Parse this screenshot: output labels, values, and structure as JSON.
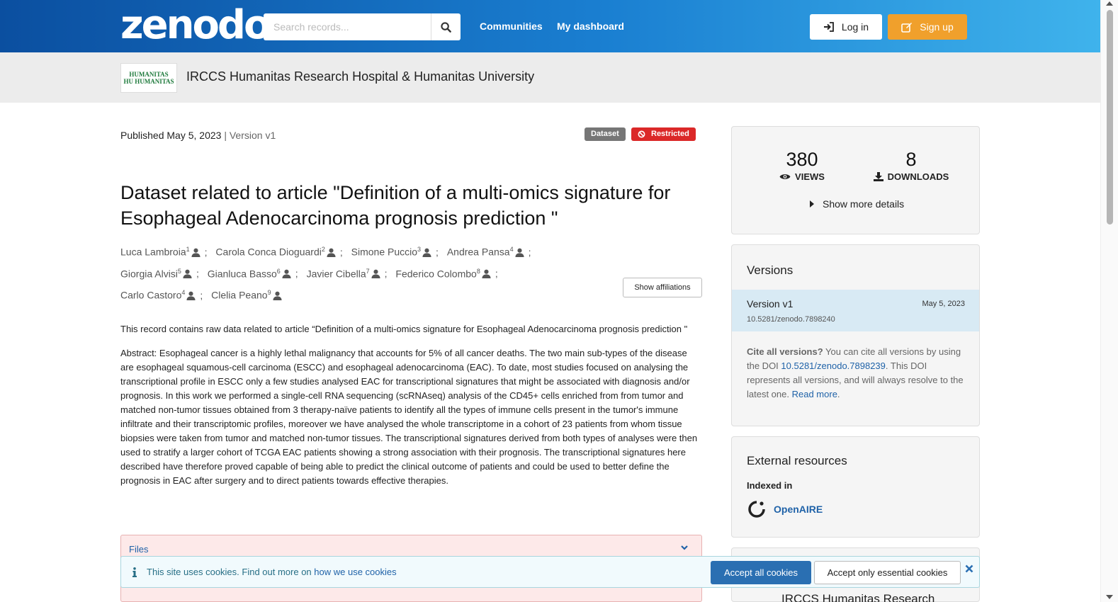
{
  "header": {
    "logo": "zenodo",
    "search_placeholder": "Search records...",
    "nav": [
      "Communities",
      "My dashboard"
    ],
    "login_label": "Log in",
    "signup_label": "Sign up"
  },
  "community": {
    "logo_lines": [
      "HUMANITAS",
      "HU HUMANITAS"
    ],
    "name": "IRCCS Humanitas Research Hospital & Humanitas University"
  },
  "record": {
    "published": "Published May 5, 2023",
    "version_sep": " | ",
    "version": "Version v1",
    "badge_type": "Dataset",
    "badge_access": "Restricted",
    "title": "Dataset related to article \"Definition of a multi-omics signature for Esophageal Adenocarcinoma prognosis prediction \"",
    "authors": [
      {
        "name": "Luca Lambroia",
        "aff": "1"
      },
      {
        "name": "Carola Conca Dioguardi",
        "aff": "2"
      },
      {
        "name": "Simone Puccio",
        "aff": "3"
      },
      {
        "name": "Andrea Pansa",
        "aff": "4"
      },
      {
        "name": "Giorgia Alvisi",
        "aff": "5"
      },
      {
        "name": "Gianluca Basso",
        "aff": "6"
      },
      {
        "name": "Javier Cibella",
        "aff": "7"
      },
      {
        "name": "Federico Colombo",
        "aff": "8"
      },
      {
        "name": "Carlo Castoro",
        "aff": "4"
      },
      {
        "name": "Clelia Peano",
        "aff": "9"
      }
    ],
    "author_sep": ";",
    "show_affiliations_label": "Show affiliations",
    "description_1": "This record contains raw data related to article “Definition of a  multi-omics signature for Esophageal Adenocarcinoma prognosis prediction \"",
    "description_2": "Abstract: Esophageal cancer is a highly lethal malignancy that accounts for 5% of all cancer deaths. The two main sub-types of the disease are esophageal squamous-cell carcinoma (ESCC) and esophageal adenocarcinoma (EAC). To date, most studies focused on analysing the transcriptional profile in ESCC only a few studies analysed EAC for transcriptional signatures that might be associated with diagnosis and/or prognosis. In this work we performed a single-cell RNA sequencing (scRNAseq) analysis of the CD45+ cells enriched from from tumor and matched non-tumor tissues obtained from 3 therapy-naïve patients to identify all the types of immune cells present in the tumor's immune infiltrate and their transcriptomic profiles, moreover we have analysed the whole transcriptome in a cohort of 23 patients from whom tissue biopsies were taken from tumor and matched non-tumor tissues. The transcriptional signatures derived from both types of analyses were then used to stratify a larger cohort of TCGA EAC patients showing a strong association with their prognosis. The transcriptional signatures here described have therefore proved capable of being able to predict the clinical outcome of patients and could be used to better define the prognosis in EAC after surgery and to direct patients towards effective therapies.",
    "files_label": "Files"
  },
  "sidebar": {
    "views_count": "380",
    "views_label": "VIEWS",
    "downloads_count": "8",
    "downloads_label": "DOWNLOADS",
    "more_details_label": "Show more details",
    "versions_title": "Versions",
    "version_item": {
      "name": "Version v1",
      "date": "May 5, 2023",
      "doi": "10.5281/zenodo.7898240"
    },
    "cite_bold": "Cite all versions?",
    "cite_text_1": " You can cite all versions by using the DOI ",
    "cite_doi": "10.5281/zenodo.7898239",
    "cite_text_2": ". This DOI represents all versions, and will always resolve to the latest one. ",
    "cite_read_more": "Read more",
    "cite_end": ".",
    "external_title": "External resources",
    "indexed_in": "Indexed in",
    "openaire": "OpenAIRE",
    "community_card_title": "IRCCS Humanitas Research"
  },
  "cookie": {
    "text": "This site uses cookies. Find out more on ",
    "link": "how we use cookies",
    "accept_all": "Accept all cookies",
    "accept_essential": "Accept only essential cookies"
  },
  "colors": {
    "header_start": "#0b4fa0",
    "header_end": "#3fb3ec",
    "signup": "#f0a02c",
    "restricted": "#db2828",
    "link": "#1f62a8"
  }
}
